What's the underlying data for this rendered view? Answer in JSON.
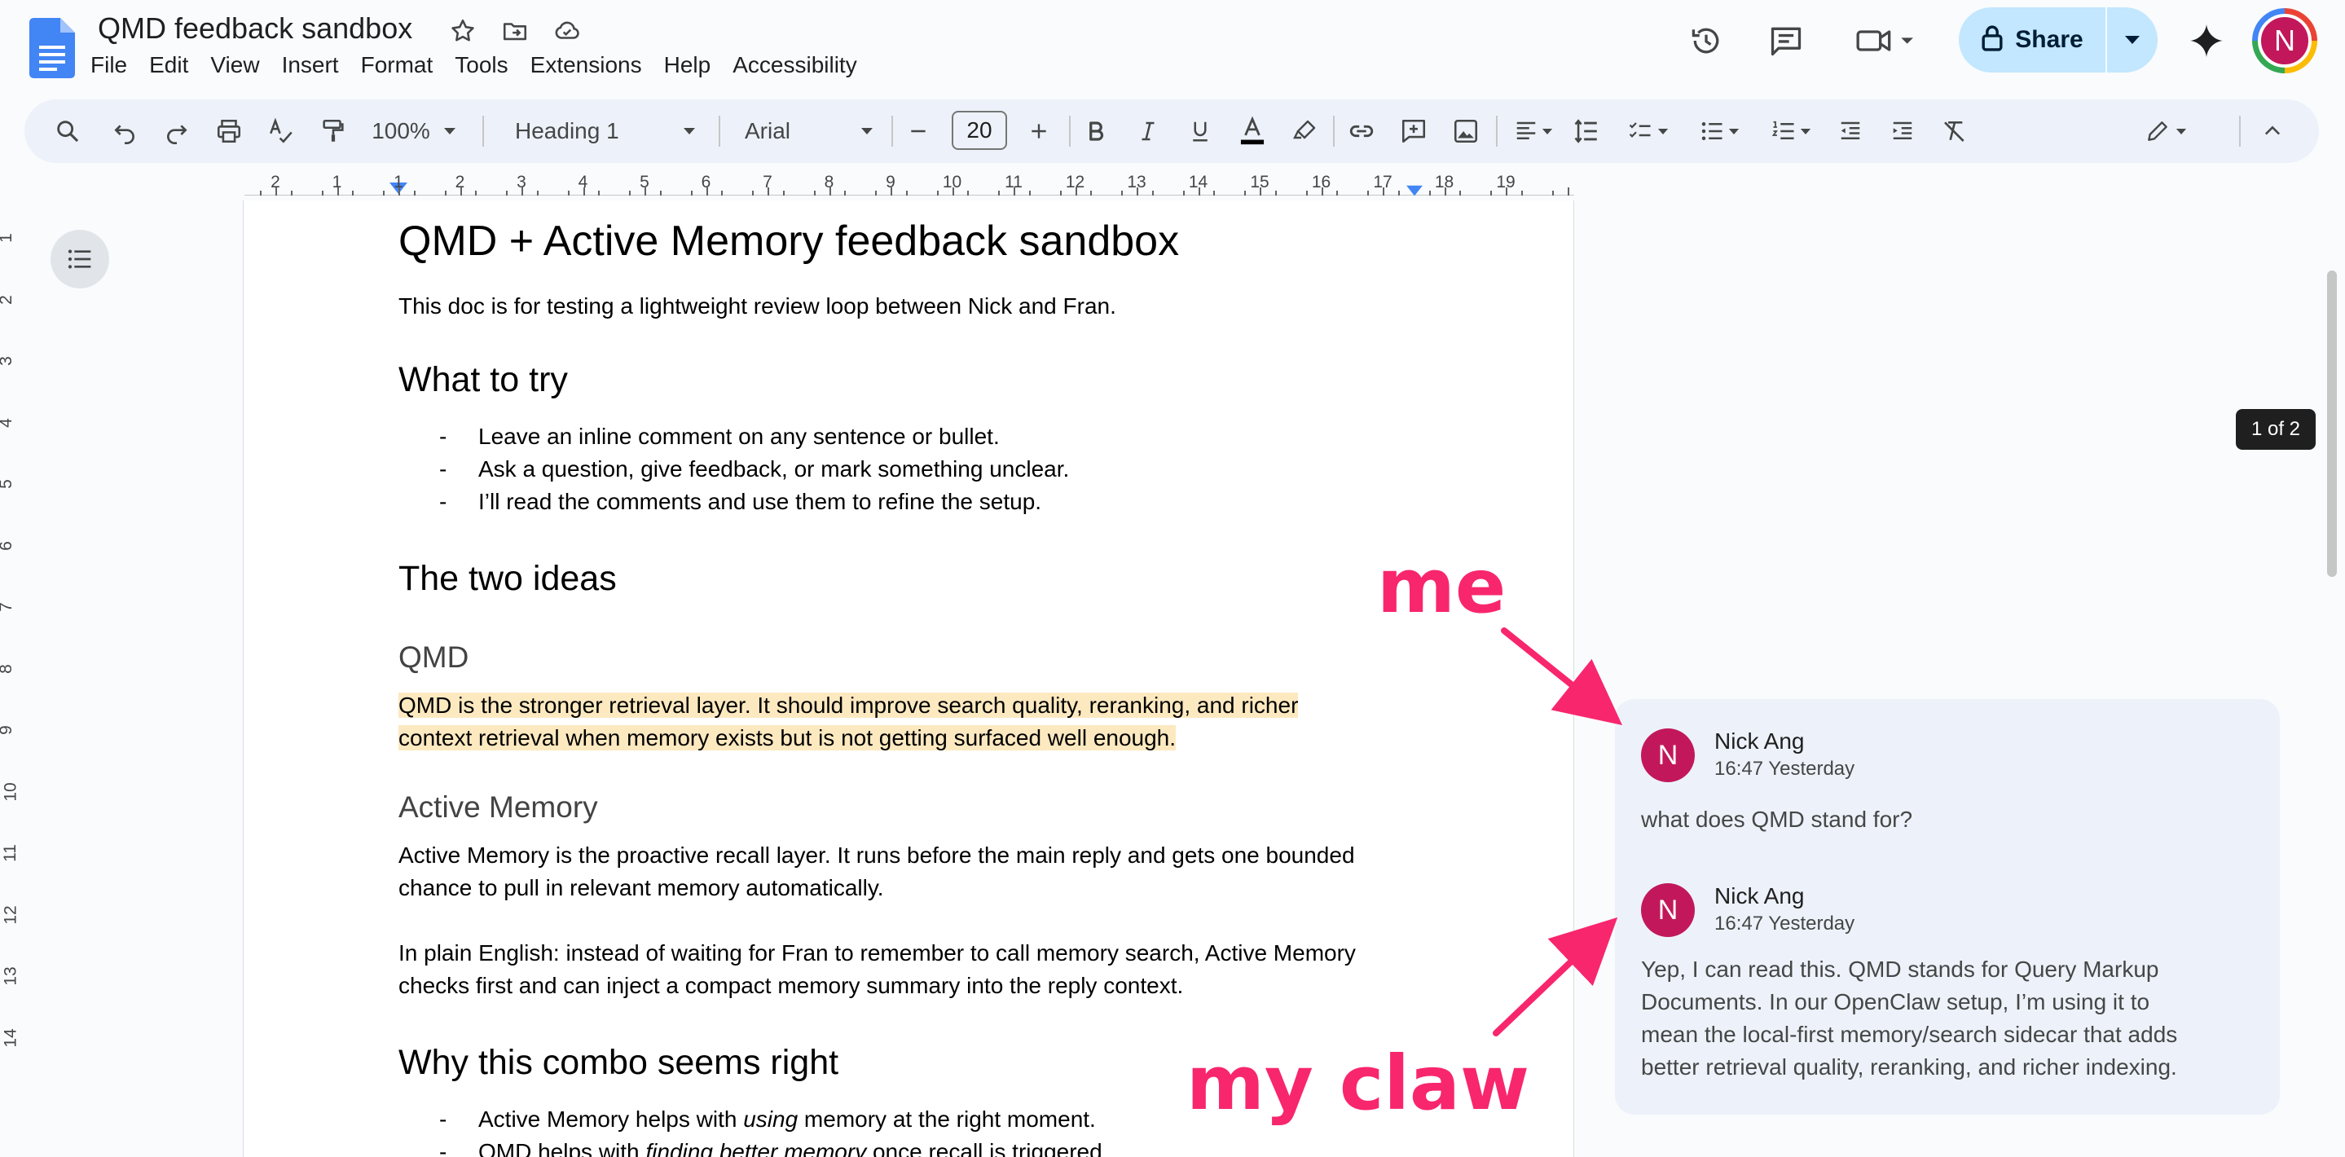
{
  "app": {
    "title": "QMD feedback sandbox",
    "menu": [
      "File",
      "Edit",
      "View",
      "Insert",
      "Format",
      "Tools",
      "Extensions",
      "Help",
      "Accessibility"
    ],
    "share_label": "Share",
    "user_initial": "N",
    "accent_color": "#c2e7ff",
    "avatar_color": "#c2185b"
  },
  "toolbar": {
    "zoom": "100%",
    "style": "Heading 1",
    "font": "Arial",
    "font_size": "20"
  },
  "ruler": {
    "numbers": [
      "2",
      "1",
      "1",
      "2",
      "3",
      "4",
      "5",
      "6",
      "7",
      "8",
      "9",
      "10",
      "11",
      "12",
      "13",
      "14",
      "15",
      "16",
      "17",
      "18",
      "19"
    ],
    "vertical_numbers": [
      "1",
      "2",
      "3",
      "4",
      "5",
      "6",
      "7",
      "8",
      "9",
      "10",
      "11",
      "12",
      "13",
      "14"
    ]
  },
  "document": {
    "title": "QMD + Active Memory feedback sandbox",
    "intro": "This doc is for testing a lightweight review loop between Nick and Fran.",
    "what_to_try": {
      "heading": "What to try",
      "bullets": [
        "Leave an inline comment on any sentence or bullet.",
        "Ask a question, give feedback, or mark something unclear.",
        "I’ll read the comments and use them to refine the setup."
      ]
    },
    "two_ideas": {
      "heading": "The two ideas",
      "qmd_heading": "QMD",
      "qmd_line1": "QMD is the stronger retrieval layer. It should improve search quality, reranking, and richer",
      "qmd_line2": "context retrieval when memory exists but is not getting surfaced well enough.",
      "am_heading": "Active Memory",
      "am_line1": "Active Memory is the proactive recall layer. It runs before the main reply and gets one bounded",
      "am_line2": "chance to pull in relevant memory automatically.",
      "plain_line1": "In plain English: instead of waiting for Fran to remember to call memory search, Active Memory",
      "plain_line2": "checks first and can inject a compact memory summary into the reply context."
    },
    "why": {
      "heading": "Why this combo seems right",
      "b1_pre": "Active Memory helps with ",
      "b1_em": "using",
      "b1_post": " memory at the right moment.",
      "b2_pre": "QMD helps with ",
      "b2_em": "finding better memory",
      "b2_post": " once recall is triggered."
    },
    "bullet_marker": "-"
  },
  "comments": {
    "indicator": "1 of 2",
    "items": [
      {
        "initial": "N",
        "author": "Nick Ang",
        "time": "16:47 Yesterday",
        "lines": [
          "what does QMD stand for?"
        ]
      },
      {
        "initial": "N",
        "author": "Nick Ang",
        "time": "16:47 Yesterday",
        "lines": [
          "Yep, I can read this. QMD stands for Query Markup",
          "Documents. In our OpenClaw setup, I’m using it to",
          "mean the local-first memory/search sidecar that adds",
          "better retrieval quality, reranking, and richer indexing."
        ]
      }
    ]
  },
  "annotations": {
    "me": "me",
    "my_claw": "my claw",
    "color": "#f8266d"
  }
}
